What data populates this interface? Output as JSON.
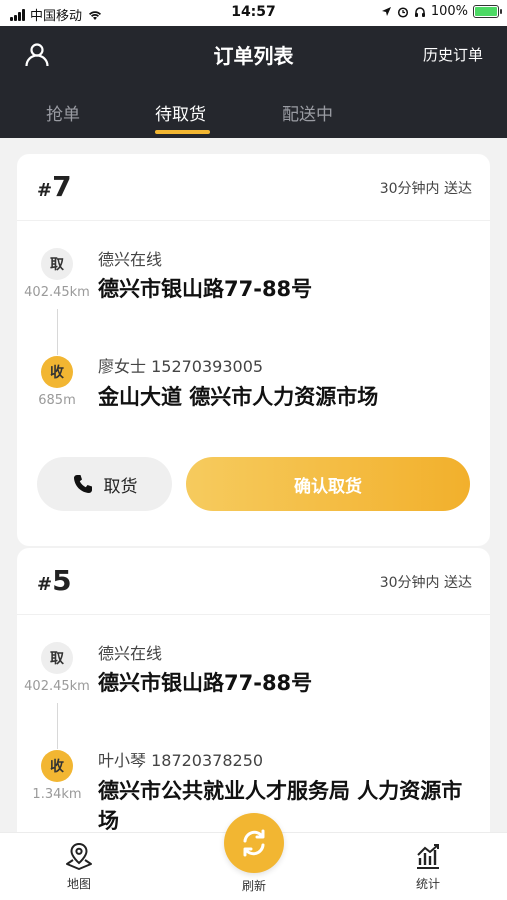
{
  "status_bar": {
    "carrier": "中国移动",
    "time": "14:57",
    "battery": "100%"
  },
  "header": {
    "title": "订单列表",
    "history_label": "历史订单"
  },
  "tabs": [
    {
      "label": "抢单",
      "active": false
    },
    {
      "label": "待取货",
      "active": true
    },
    {
      "label": "配送中",
      "active": false
    }
  ],
  "orders": [
    {
      "hash": "#",
      "number": "7",
      "eta": "30分钟内 送达",
      "pickup": {
        "badge": "取",
        "distance": "402.45km",
        "name": "德兴在线",
        "address": "德兴市银山路77-88号"
      },
      "dropoff": {
        "badge": "收",
        "distance": "685m",
        "name": "廖女士 15270393005",
        "address": "金山大道 德兴市人力资源市场"
      },
      "call_label": "取货",
      "confirm_label": "确认取货"
    },
    {
      "hash": "#",
      "number": "5",
      "eta": "30分钟内 送达",
      "pickup": {
        "badge": "取",
        "distance": "402.45km",
        "name": "德兴在线",
        "address": "德兴市银山路77-88号"
      },
      "dropoff": {
        "badge": "收",
        "distance": "1.34km",
        "name": "叶小琴 18720378250",
        "address": "德兴市公共就业人才服务局 人力资源市场"
      }
    }
  ],
  "bottom_nav": {
    "map_label": "地图",
    "refresh_label": "刷新",
    "stats_label": "统计"
  },
  "colors": {
    "accent": "#f2b632",
    "header_bg": "#25272d",
    "page_bg": "#f2f2f2"
  }
}
